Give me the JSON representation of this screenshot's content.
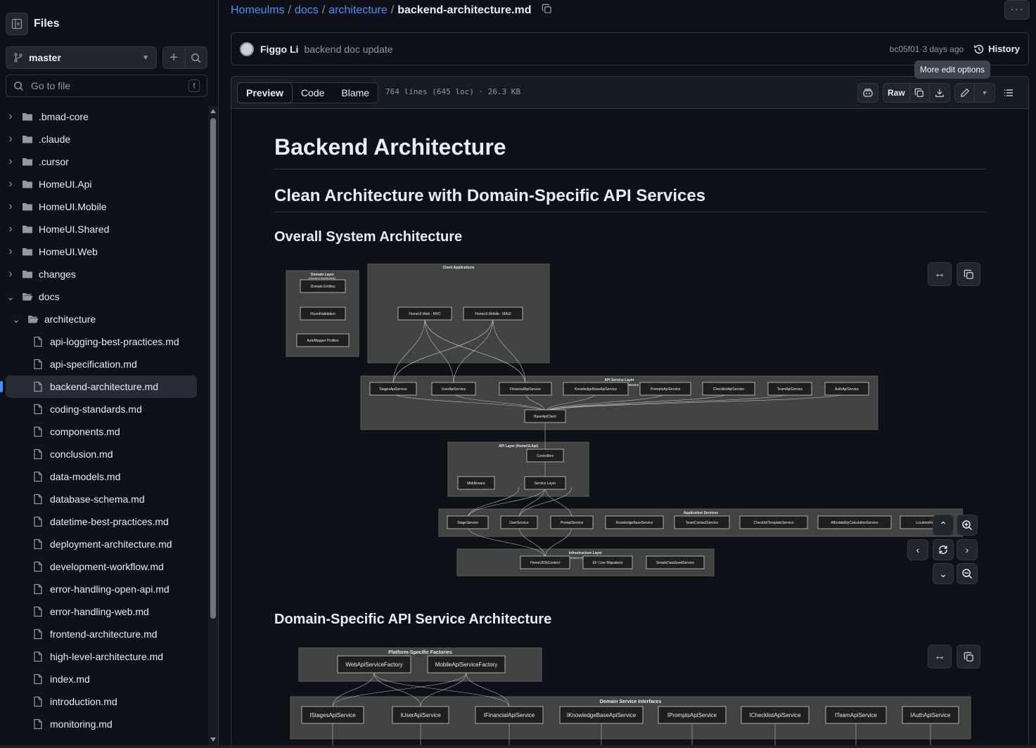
{
  "sidebar": {
    "title": "Files",
    "branch": "master",
    "goto_placeholder": "Go to file",
    "goto_shortcut": "t",
    "tree": [
      {
        "label": ".bmad-core",
        "type": "folder",
        "depth": 0,
        "expanded": false
      },
      {
        "label": ".claude",
        "type": "folder",
        "depth": 0,
        "expanded": false
      },
      {
        "label": ".cursor",
        "type": "folder",
        "depth": 0,
        "expanded": false
      },
      {
        "label": "HomeUI.Api",
        "type": "folder",
        "depth": 0,
        "expanded": false
      },
      {
        "label": "HomeUI.Mobile",
        "type": "folder",
        "depth": 0,
        "expanded": false
      },
      {
        "label": "HomeUI.Shared",
        "type": "folder",
        "depth": 0,
        "expanded": false
      },
      {
        "label": "HomeUI.Web",
        "type": "folder",
        "depth": 0,
        "expanded": false
      },
      {
        "label": "changes",
        "type": "folder",
        "depth": 0,
        "expanded": false
      },
      {
        "label": "docs",
        "type": "folder",
        "depth": 0,
        "expanded": true
      },
      {
        "label": "architecture",
        "type": "folder",
        "depth": 1,
        "expanded": true
      },
      {
        "label": "api-logging-best-practices.md",
        "type": "file",
        "depth": 2
      },
      {
        "label": "api-specification.md",
        "type": "file",
        "depth": 2
      },
      {
        "label": "backend-architecture.md",
        "type": "file",
        "depth": 2,
        "active": true
      },
      {
        "label": "coding-standards.md",
        "type": "file",
        "depth": 2
      },
      {
        "label": "components.md",
        "type": "file",
        "depth": 2
      },
      {
        "label": "conclusion.md",
        "type": "file",
        "depth": 2
      },
      {
        "label": "data-models.md",
        "type": "file",
        "depth": 2
      },
      {
        "label": "database-schema.md",
        "type": "file",
        "depth": 2
      },
      {
        "label": "datetime-best-practices.md",
        "type": "file",
        "depth": 2
      },
      {
        "label": "deployment-architecture.md",
        "type": "file",
        "depth": 2
      },
      {
        "label": "development-workflow.md",
        "type": "file",
        "depth": 2
      },
      {
        "label": "error-handling-open-api.md",
        "type": "file",
        "depth": 2
      },
      {
        "label": "error-handling-web.md",
        "type": "file",
        "depth": 2
      },
      {
        "label": "frontend-architecture.md",
        "type": "file",
        "depth": 2
      },
      {
        "label": "high-level-architecture.md",
        "type": "file",
        "depth": 2
      },
      {
        "label": "index.md",
        "type": "file",
        "depth": 2
      },
      {
        "label": "introduction.md",
        "type": "file",
        "depth": 2
      },
      {
        "label": "monitoring.md",
        "type": "file",
        "depth": 2
      }
    ]
  },
  "breadcrumb": {
    "repo": "Homeulms",
    "p1": "docs",
    "p2": "architecture",
    "file": "backend-architecture.md"
  },
  "commit": {
    "author": "Figgo Li",
    "message": "backend doc update",
    "sha": "bc05f01",
    "sep": " · ",
    "when": "3 days ago",
    "history": "History"
  },
  "tooltip": "More edit options",
  "file_header": {
    "tabs": [
      "Preview",
      "Code",
      "Blame"
    ],
    "active_tab": "Preview",
    "info": "764 lines (645 loc) · 26.3 KB",
    "raw": "Raw"
  },
  "doc": {
    "h1": "Backend Architecture",
    "h2": "Clean Architecture with Domain-Specific API Services",
    "h3a": "Overall System Architecture",
    "h3b": "Domain-Specific API Service Architecture"
  },
  "diagram1": {
    "domain_layer": "Domain Layer",
    "domain_sub": "(HomeUI.Api/Models)",
    "domain_nodes": [
      "Domain Entities",
      "FluentValidation",
      "AutoMapper Profiles"
    ],
    "client_apps": "Client Applications",
    "client_nodes": [
      "HomeUI.Web - MVC",
      "HomeUI.Mobile - MAUI"
    ],
    "api_service_layer": "API Service Layer",
    "api_service_sub": "Service",
    "api_services": [
      "StagesApiService",
      "UserApiService",
      "FinancialApiService",
      "KnowledgeBaseApiService",
      "PromptsApiService",
      "ChecklistApiService",
      "TeamApiService",
      "AuthApiService"
    ],
    "base_client": "BaseApiClient",
    "api_layer": "API Layer (HomeUI.Api)",
    "api_nodes": [
      "Controllers",
      "Middleware",
      "Service Layer"
    ],
    "app_services": "Application Services",
    "app_nodes": [
      "StageService",
      "UserService",
      "PromptService",
      "KnowledgeBaseService",
      "TeamContactService",
      "ChecklistTemplateService",
      "AffordabilityCalculationService",
      "LocationRe"
    ],
    "infra": "Infrastructure Layer",
    "infra_sub": "HomeUI.Ap",
    "infra_nodes": [
      "HomeUIDbContext",
      "EF Core Migrations",
      "SimpleDataSeedService"
    ]
  },
  "diagram2": {
    "factories": "Platform-Specific Factories",
    "factory_nodes": [
      "WebApiServiceFactory",
      "MobileApiServiceFactory"
    ],
    "interfaces": "Domain Service Interfaces",
    "interface_nodes": [
      "IStagesApiService",
      "IUserApiService",
      "IFinancialApiService",
      "IKnowledgeBaseApiService",
      "IPromptsApiService",
      "IChecklistApiService",
      "ITeamApiService",
      "IAuthApiService"
    ]
  },
  "icons": {
    "sidebar_toggle": "sidebar-collapse-icon",
    "branch": "git-branch-icon",
    "plus": "plus-icon",
    "search": "search-icon",
    "folder": "folder-icon",
    "file": "file-icon",
    "copy": "copy-icon",
    "history": "history-icon",
    "copilot": "copilot-icon",
    "download": "download-icon",
    "pencil": "pencil-icon",
    "outline": "list-icon"
  },
  "colors": {
    "accent": "#4493f8",
    "bg": "#0d1117",
    "diagram_cluster": "#434343",
    "diagram_node": "#1f1f1f"
  }
}
